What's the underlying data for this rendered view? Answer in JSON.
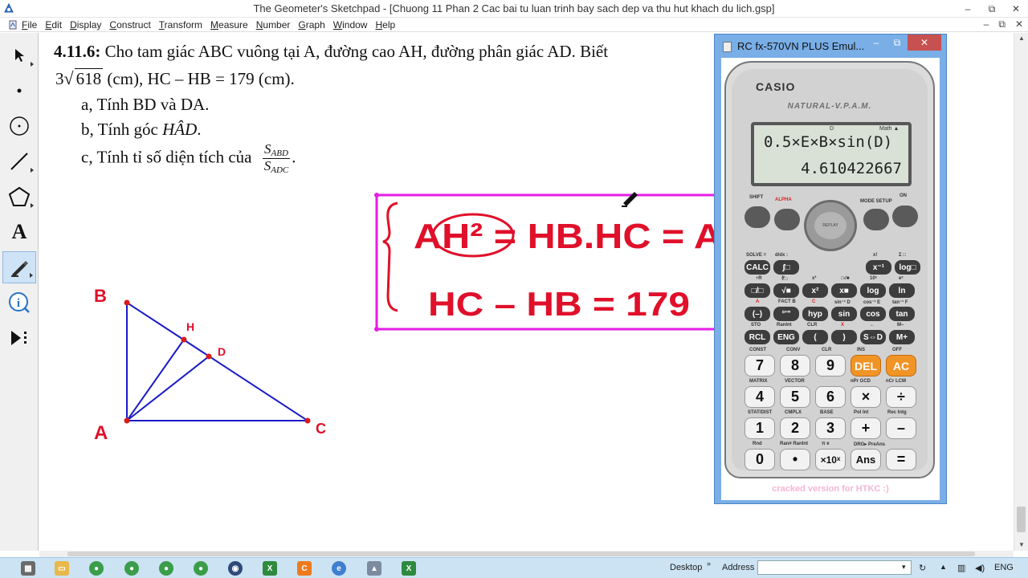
{
  "window": {
    "title": "The Geometer's Sketchpad - [Chuong 11 Phan 2 Cac bai tu luan trinh bay sach dep va thu hut khach du lich.gsp]",
    "minimize": "–",
    "maximize": "⧉",
    "close": "✕"
  },
  "menu": {
    "items": [
      "File",
      "Edit",
      "Display",
      "Construct",
      "Transform",
      "Measure",
      "Number",
      "Graph",
      "Window",
      "Help"
    ],
    "doc_controls": [
      "–",
      "⧉",
      "✕"
    ]
  },
  "toolbox": {
    "tools": [
      "arrow-tool",
      "point-tool",
      "compass-tool",
      "straightedge-tool",
      "polygon-tool",
      "text-tool",
      "marker-tool",
      "information-tool",
      "custom-tool"
    ],
    "active": "marker-tool",
    "text_tool_glyph": "A"
  },
  "problem": {
    "number": "4.11.6:",
    "line1": " Cho tam giác ABC vuông tại A, đường cao AH, đường phân giác AD. Biết",
    "sqrt_coef": "3",
    "sqrt_radicand": "618",
    "line2_rest": "  (cm), HC – HB = 179 (cm).",
    "part_a": "a, Tính BD và DA.",
    "part_b_prefix": "b, Tính góc  ",
    "part_b_angle": "HÂD",
    "part_b_suffix": ".",
    "part_c_prefix": "c, Tính tỉ số diện tích của",
    "frac_num_letter": "S",
    "frac_num_sub": "ABD",
    "frac_den_letter": "S",
    "frac_den_sub": "ADC",
    "part_c_suffix": "."
  },
  "figure": {
    "labels": [
      "B",
      "H",
      "D",
      "A",
      "C"
    ],
    "line_color": "#1b1bc8",
    "point_color": "#d81b1b",
    "ink_color": "#e0102a",
    "box_color": "#e61ee6"
  },
  "annotations": {
    "line1": "AH² = HB.HC = A",
    "line2": "HC – HB = 179"
  },
  "calculator": {
    "title": "RC fx-570VN PLUS Emul...",
    "brand": "CASIO",
    "subtitle": "NATURAL-V.P.A.M.",
    "display_indicators": [
      "D",
      "Math ▲"
    ],
    "expression": "0.5×E×B×sin(D)",
    "result": "4.610422667",
    "top_labels": [
      "SHIFT",
      "ALPHA",
      "MODE SETUP",
      "ON"
    ],
    "replay": "REPLAY",
    "row1": [
      "CALC",
      "∫□",
      "x⁻¹",
      "log□"
    ],
    "row2": [
      "□/□",
      "√■",
      "x²",
      "x■",
      "log",
      "ln"
    ],
    "row3": [
      "(–)",
      "°'\"",
      "hyp",
      "sin",
      "cos",
      "tan"
    ],
    "row4": [
      "RCL",
      "ENG",
      "(",
      ")",
      "S⇔D",
      "M+"
    ],
    "row5": [
      "7",
      "8",
      "9",
      "DEL",
      "AC"
    ],
    "row6": [
      "4",
      "5",
      "6",
      "×",
      "÷"
    ],
    "row7": [
      "1",
      "2",
      "3",
      "+",
      "–"
    ],
    "row8": [
      "0",
      "•",
      "×10ˣ",
      "Ans",
      "="
    ],
    "small_labels": {
      "row1": [
        "SOLVE =",
        "d/dx :",
        "x!",
        "Σ □"
      ],
      "row2": [
        "÷R",
        "∛□",
        "x³",
        "□√■",
        "10ˣ",
        "eˣ"
      ],
      "row3": [
        "A",
        "FACT B",
        "C",
        "sin⁻¹ D",
        "cos⁻¹ E",
        "tan⁻¹ F"
      ],
      "row4": [
        "STO",
        "RanInt",
        "CLR",
        "X",
        "←",
        "M–"
      ],
      "row5": [
        "CONST",
        "CONV",
        "CLR",
        "INS",
        "OFF"
      ],
      "row6": [
        "MATRIX",
        "VECTOR",
        "nPr GCD",
        "nCr LCM"
      ],
      "row7": [
        "STAT/DIST",
        "CMPLX",
        "BASE",
        "Pol Int",
        "Rec Intg"
      ],
      "row8": [
        "Rnd",
        "Ran# RanInt",
        "π  e",
        "DRG▸ PreAns"
      ]
    },
    "footer": "cracked version for HTKC :)"
  },
  "taskbar": {
    "apps": [
      "Windows Explorer",
      "Chrome",
      "Chrome",
      "Chrome",
      "Chrome",
      "Media",
      "Excel",
      "CocCoc",
      "Explorer",
      "Sketchpad",
      "Excel"
    ],
    "desktop_label": "Desktop",
    "address_label": "Address",
    "language": "ENG"
  }
}
